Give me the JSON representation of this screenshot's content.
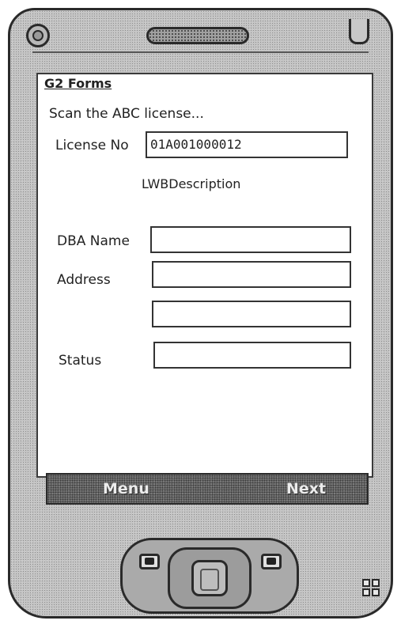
{
  "app": {
    "title": "G2 Forms"
  },
  "form": {
    "instruction": "Scan the ABC license...",
    "license_label": "License No",
    "license_value": "01A001000012",
    "description_label": "LWBDescription",
    "dba_label": "DBA Name",
    "dba_value": "",
    "address_label": "Address",
    "address_line1_value": "",
    "address_line2_value": "",
    "status_label": "Status",
    "status_value": ""
  },
  "softkeys": {
    "left_label": "Menu",
    "right_label": "Next"
  },
  "colors": {
    "screen_bg": "#ffffff",
    "softkey_bar": "#6f6f6f",
    "device_body": "#c4c4c4"
  },
  "icons": [
    "power-icon",
    "speaker-grille",
    "call-icon",
    "end-call-icon",
    "dpad-icon",
    "windows-logo-icon"
  ]
}
